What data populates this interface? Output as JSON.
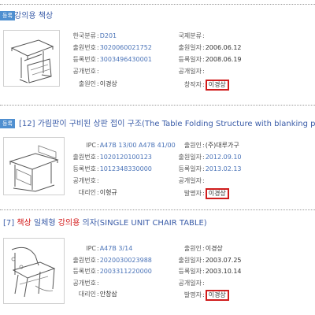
{
  "records": [
    {
      "status": "등록",
      "title_pre": "",
      "title_parts": [
        {
          "t": "강의용 책상",
          "hl": false
        }
      ],
      "left_fields": [
        {
          "label": "한국분류",
          "value": "D201",
          "style": "link"
        },
        {
          "label": "출원번호",
          "value": "3020060021752",
          "style": "link"
        },
        {
          "label": "등록번호",
          "value": "3003496430001",
          "style": "link"
        },
        {
          "label": "공개번호",
          "value": "",
          "style": "plain"
        },
        {
          "label": "출원인",
          "value": "이경상",
          "style": "plain"
        }
      ],
      "right_fields": [
        {
          "label": "국제분류",
          "value": "",
          "style": "plain"
        },
        {
          "label": "출원일자",
          "value": "2006.06.12",
          "style": "plain"
        },
        {
          "label": "등록일자",
          "value": "2008.06.19",
          "style": "plain"
        },
        {
          "label": "공개일자",
          "value": "",
          "style": "plain"
        },
        {
          "label": "창작자",
          "value": "이경상",
          "style": "highlight"
        }
      ]
    },
    {
      "status": "등록",
      "title_pre": "[12] ",
      "title_parts": [
        {
          "t": "가림판이 구비된 상판 접이 구조(The Table Folding Structure with blanking pla",
          "hl": false
        }
      ],
      "left_fields": [
        {
          "label": "IPC",
          "value": "A47B 13/00   A47B 41/00",
          "style": "link"
        },
        {
          "label": "출원번호",
          "value": "1020120100123",
          "style": "link"
        },
        {
          "label": "등록번호",
          "value": "1012348330000",
          "style": "link"
        },
        {
          "label": "공개번호",
          "value": "",
          "style": "plain"
        },
        {
          "label": "대리인",
          "value": "이형규",
          "style": "plain"
        }
      ],
      "right_fields": [
        {
          "label": "출원인",
          "value": "(주)대루가구",
          "style": "plain"
        },
        {
          "label": "출원일자",
          "value": "2012.09.10",
          "style": "link"
        },
        {
          "label": "등록일자",
          "value": "2013.02.13",
          "style": "link"
        },
        {
          "label": "공개일자",
          "value": "",
          "style": "plain"
        },
        {
          "label": "발명자",
          "value": "이경상",
          "style": "highlight"
        }
      ]
    },
    {
      "status": "",
      "title_pre": "[7] ",
      "title_parts": [
        {
          "t": "책상",
          "hl": true
        },
        {
          "t": " 일체형 ",
          "hl": false
        },
        {
          "t": "강의용",
          "hl": true
        },
        {
          "t": " 의자(SINGLE UNIT CHAIR TABLE)",
          "hl": false
        }
      ],
      "left_fields": [
        {
          "label": "IPC",
          "value": "A47B 3/14",
          "style": "link"
        },
        {
          "label": "출원번호",
          "value": "2020030023988",
          "style": "link"
        },
        {
          "label": "등록번호",
          "value": "2003311220000",
          "style": "link"
        },
        {
          "label": "공개번호",
          "value": "",
          "style": "plain"
        },
        {
          "label": "대리인",
          "value": "안창삼",
          "style": "plain"
        }
      ],
      "right_fields": [
        {
          "label": "출원인",
          "value": "이경상",
          "style": "plain"
        },
        {
          "label": "출원일자",
          "value": "2003.07.25",
          "style": "plain"
        },
        {
          "label": "등록일자",
          "value": "2003.10.14",
          "style": "plain"
        },
        {
          "label": "공개일자",
          "value": "",
          "style": "plain"
        },
        {
          "label": "발명자",
          "value": "이경상",
          "style": "highlight"
        }
      ]
    }
  ]
}
